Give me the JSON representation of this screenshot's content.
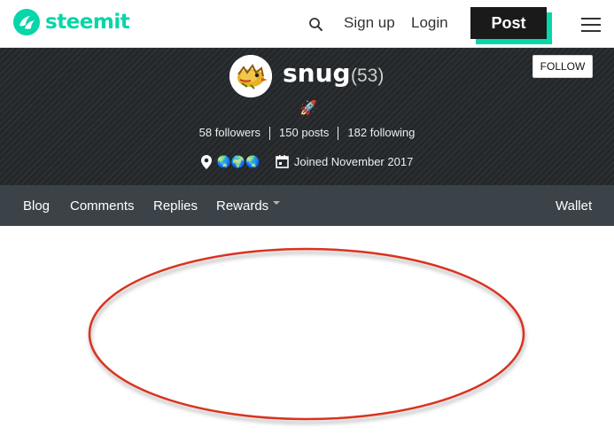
{
  "header": {
    "brand": "steemit",
    "brand_color": "#06d6a9",
    "search_icon": "search-icon",
    "signup_label": "Sign up",
    "login_label": "Login",
    "post_label": "Post",
    "menu_icon": "hamburger-menu-icon"
  },
  "profile": {
    "username": "snug",
    "reputation": "(53)",
    "follow_label": "FOLLOW",
    "about": "🚀",
    "followers": "58 followers",
    "posts": "150 posts",
    "following": "182 following",
    "location": "🌏🌍🌏",
    "joined": "Joined November 2017"
  },
  "tabs": {
    "items": [
      {
        "label": "Blog"
      },
      {
        "label": "Comments"
      },
      {
        "label": "Replies"
      },
      {
        "label": "Rewards"
      }
    ],
    "wallet_label": "Wallet"
  },
  "annotation": {
    "shape": "oval",
    "color": "#d93320"
  }
}
